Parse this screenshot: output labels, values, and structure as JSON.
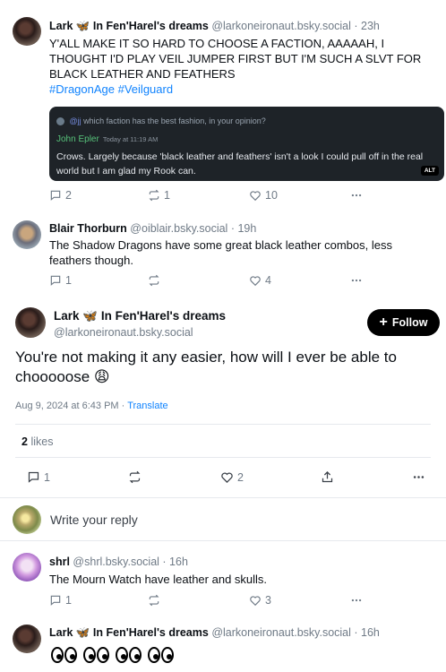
{
  "post1": {
    "author": "Lark 🦋 In Fen'Harel's dreams",
    "handle": "@larkoneironaut.bsky.social",
    "time": "· 23h",
    "text": "Y'ALL MAKE IT SO HARD TO CHOOSE A FACTION, AAAAAH, I THOUGHT I'D PLAY VEIL JUMPER FIRST BUT I'M SUCH A SLVT FOR BLACK LEATHER AND FEATHERS",
    "hashtag1": "#DragonAge",
    "hashtag2": "#Veilguard",
    "quote": {
      "context_handle": "@jj",
      "context_text": "which faction has the best fashion, in your opinion?",
      "name": "John Epler",
      "time": "Today at 11:19 AM",
      "body": "Crows. Largely because 'black leather and feathers' isn't a look I could pull off in the real world but I am glad my Rook can.",
      "alt": "ALT"
    },
    "replies": "2",
    "reposts": "1",
    "likes": "10"
  },
  "post2": {
    "author": "Blair Thorburn",
    "handle": "@oiblair.bsky.social",
    "time": "· 19h",
    "text": "The Shadow Dragons have some great black leather combos, less feathers though.",
    "replies": "1",
    "likes": "4"
  },
  "main": {
    "author": "Lark 🦋 In Fen'Harel's dreams",
    "handle": "@larkoneironaut.bsky.social",
    "follow_label": "Follow",
    "text": "You're not making it any easier, how will I ever be able to chooooose 😩",
    "date": "Aug 9, 2024 at 6:43 PM",
    "translate": "Translate",
    "likes_count": "2",
    "likes_label": "likes",
    "replies": "1",
    "like_count": "2"
  },
  "reply_box": {
    "placeholder": "Write your reply"
  },
  "post3": {
    "author": "shrl",
    "handle": "@shrl.bsky.social",
    "time": "· 16h",
    "text": "The Mourn Watch have leather and skulls.",
    "replies": "1",
    "likes": "3"
  },
  "post4": {
    "author": "Lark 🦋 In Fen'Harel's dreams",
    "handle": "@larkoneironaut.bsky.social",
    "time": "· 16h"
  },
  "colors": {
    "link": "#1083fe",
    "muted": "#6f7a86",
    "follow_bg": "#000000",
    "quote_bg": "#1e2328",
    "quote_name": "#57c27a"
  }
}
